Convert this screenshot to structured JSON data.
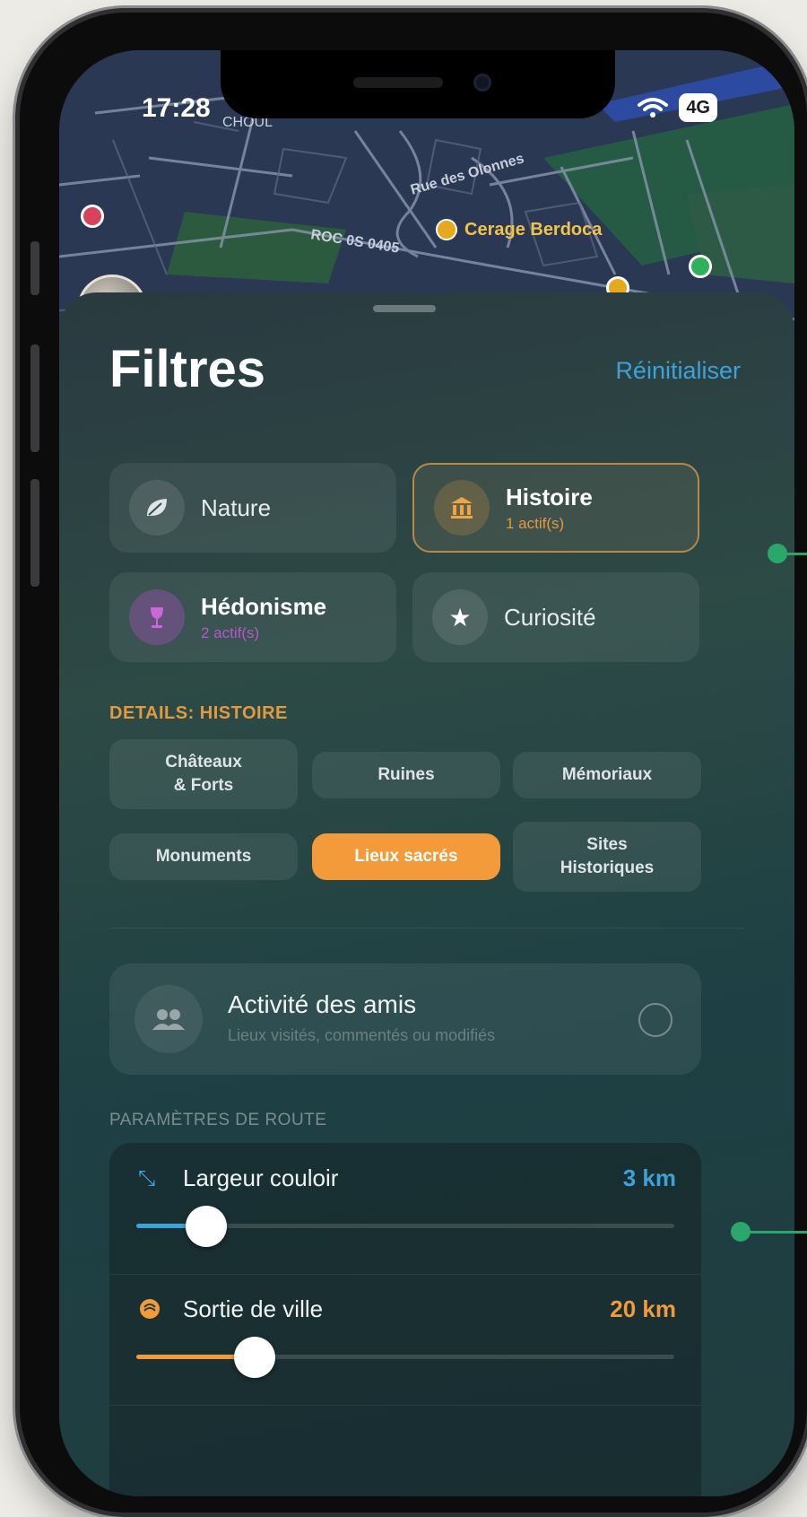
{
  "status_bar": {
    "time": "17:28",
    "network": "4G"
  },
  "map": {
    "place_label": "Cerage Berdoca",
    "street_label": "ROC 0S 0405",
    "street_label_2": "Rue des Olonnes",
    "street_label_3": "CHOUL"
  },
  "sheet": {
    "title": "Filtres",
    "reset_label": "Réinitialiser",
    "categories": [
      {
        "label": "Nature",
        "sub": ""
      },
      {
        "label": "Histoire",
        "sub": "1 actif(s)"
      },
      {
        "label": "Hédonisme",
        "sub": "2 actif(s)"
      },
      {
        "label": "Curiosité",
        "sub": ""
      }
    ],
    "details_label": "DETAILS: HISTOIRE",
    "chips": [
      {
        "label": "Châteaux\n& Forts"
      },
      {
        "label": "Ruines"
      },
      {
        "label": "Mémoriaux"
      },
      {
        "label": "Monuments"
      },
      {
        "label": "Lieux sacrés"
      },
      {
        "label": "Sites\nHistoriques"
      }
    ],
    "friends": {
      "title": "Activité des amis",
      "subtitle": "Lieux visités, commentés ou modifiés"
    },
    "route_section_label": "PARAMÈTRES DE ROUTE",
    "route": [
      {
        "label": "Largeur couloir",
        "value": "3 km",
        "level": 0.13
      },
      {
        "label": "Sortie de ville",
        "value": "20 km",
        "level": 0.22
      }
    ]
  },
  "colors": {
    "accent_blue": "#3ea2d8",
    "accent_orange": "#f39a3a",
    "history_gold": "#b8874a",
    "hedonism_purple": "#b558c9",
    "connector_green": "#2aa86a"
  }
}
